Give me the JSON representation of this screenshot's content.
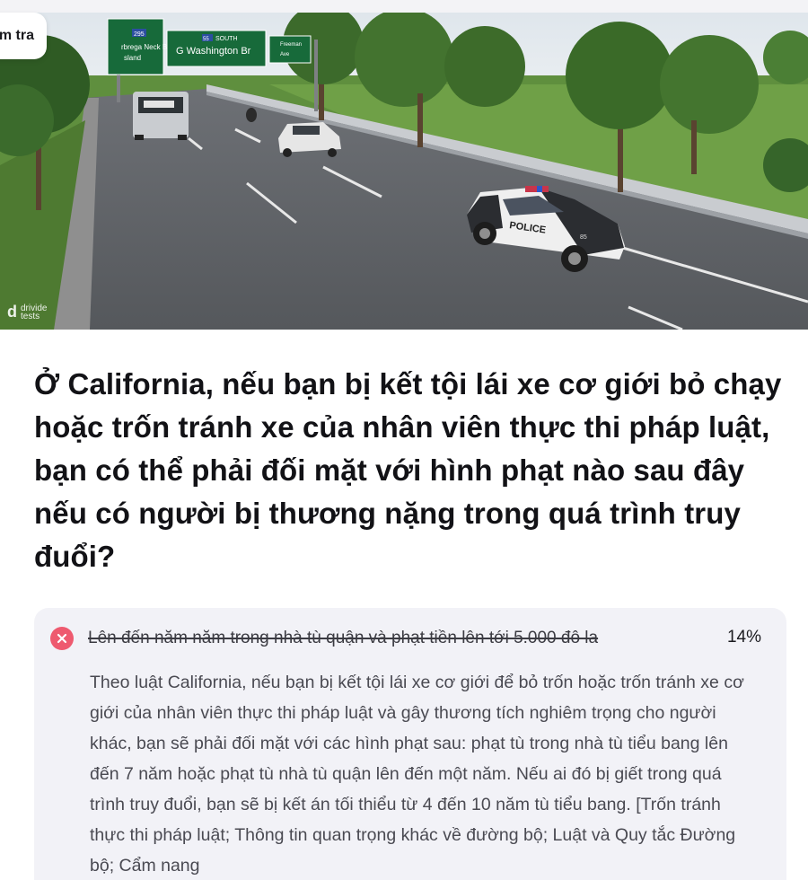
{
  "header": {
    "chip_label": "m tra"
  },
  "hero": {
    "signs": [
      "295",
      "rbrega Neck Br",
      "sland",
      "55 SOUTH",
      "G Washington Br",
      "Freeman",
      "Ave"
    ],
    "police_label": "POLICE",
    "car_number": "85",
    "watermark_mark": "d",
    "watermark_line1": "drivide",
    "watermark_line2": "tests"
  },
  "question": {
    "text": "Ở California, nếu bạn bị kết tội lái xe cơ giới bỏ chạy hoặc trốn tránh xe của nhân viên thực thi pháp luật, bạn có thể phải đối mặt với hình phạt nào sau đây nếu có người bị thương nặng trong quá trình truy đuổi?"
  },
  "answer": {
    "text": "Lên đến năm năm trong nhà tù quận và phạt tiền lên tới 5.000 đô la",
    "percent": "14%",
    "status_icon": "close-icon",
    "status_color": "#ee5a6f",
    "explanation": "Theo luật California, nếu bạn bị kết tội lái xe cơ giới để bỏ trốn hoặc trốn tránh xe cơ giới của nhân viên thực thi pháp luật và gây thương tích nghiêm trọng cho người khác, bạn sẽ phải đối mặt với các hình phạt sau: phạt tù trong nhà tù tiểu bang lên đến 7 năm hoặc phạt tù nhà tù quận lên đến một năm. Nếu ai đó bị giết trong quá trình truy đuổi, bạn sẽ bị kết án tối thiểu từ 4 đến 10 năm tù tiểu bang. [Trốn tránh thực thi pháp luật; Thông tin quan trọng khác về đường bộ; Luật và Quy tắc Đường bộ; Cẩm nang"
  }
}
